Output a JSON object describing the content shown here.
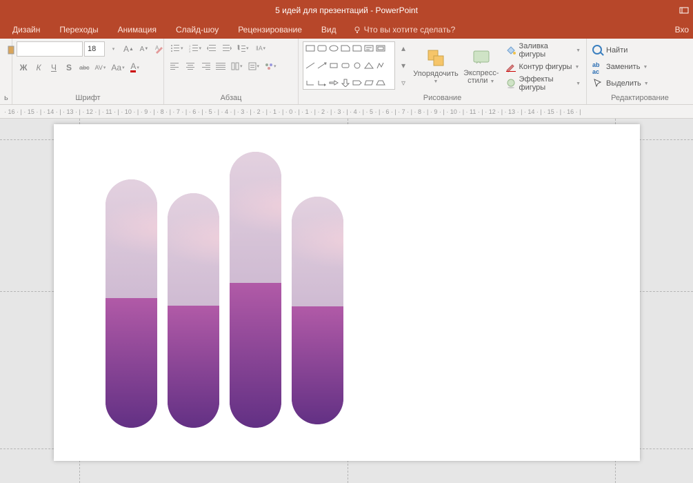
{
  "title": "5 идей для презентаций - PowerPoint",
  "menu": {
    "design": "Дизайн",
    "transitions": "Переходы",
    "animation": "Анимация",
    "slideshow": "Слайд-шоу",
    "review": "Рецензирование",
    "view": "Вид",
    "tell_me": "Что вы хотите сделать?",
    "signin_cut": "Вхо"
  },
  "font": {
    "name_value": "",
    "size_value": "18",
    "bold": "Ж",
    "italic": "К",
    "underline": "Ч",
    "shadow": "S",
    "strike": "abc",
    "char_spacing": "AV",
    "case": "Aa",
    "color": "A",
    "group_label": "Шрифт"
  },
  "paragraph": {
    "group_label": "Абзац"
  },
  "drawing": {
    "arrange": "Упорядочить",
    "quick_styles_1": "Экспресс-",
    "quick_styles_2": "стили",
    "shape_fill": "Заливка фигуры",
    "shape_outline": "Контур фигуры",
    "shape_effects": "Эффекты фигуры",
    "group_label": "Рисование"
  },
  "editing": {
    "find": "Найти",
    "replace": "Заменить",
    "select": "Выделить",
    "group_label": "Редактирование"
  },
  "ruler": "· 16 · | · 15 · | · 14 · | · 13 · | · 12 · | · 11 · | · 10 · | · 9 · | · 8 · | · 7 · | · 6 · | · 5 · | · 4 · | · 3 · | · 2 · | · 1 · | · 0 · | · 1 · | · 2 · | · 3 · | · 4 · | · 5 · | · 6 · | · 7 · | · 8 · | · 9 · | · 10 · | · 11 · | · 12 · | · 13 · | · 14 · | · 15 · | · 16 · |"
}
